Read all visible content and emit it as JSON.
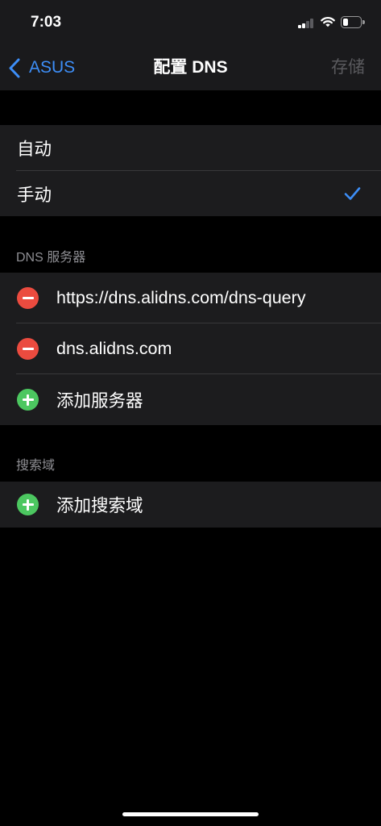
{
  "status_bar": {
    "time": "7:03",
    "signal_bars": 2,
    "battery_level": 0.3,
    "icons": [
      "cellular-signal-icon",
      "wifi-icon",
      "battery-icon"
    ]
  },
  "nav": {
    "back_icon": "chevron-left-icon",
    "back_label": "ASUS",
    "title": "配置 DNS",
    "save_label": "存储",
    "save_enabled": false
  },
  "configure_mode": {
    "options": [
      {
        "label": "自动",
        "selected": false
      },
      {
        "label": "手动",
        "selected": true
      }
    ],
    "selected_icon": "checkmark-icon"
  },
  "dns_servers": {
    "header": "DNS 服务器",
    "servers": [
      {
        "address": "https://dns.alidns.com/dns-query",
        "icon": "remove-circle-icon"
      },
      {
        "address": "dns.alidns.com",
        "icon": "remove-circle-icon"
      }
    ],
    "add": {
      "label": "添加服务器",
      "icon": "add-circle-icon"
    }
  },
  "search_domains": {
    "header": "搜索域",
    "add": {
      "label": "添加搜索域",
      "icon": "add-circle-icon"
    }
  },
  "colors": {
    "accent": "#3d8ef7",
    "destructive": "#eb4b3f",
    "positive": "#4cc760",
    "cell_background": "#1c1c1e",
    "nav_background": "#1a1a1c",
    "separator": "#38383a",
    "secondary_text": "#8e8e93",
    "disabled_text": "#59595d"
  }
}
